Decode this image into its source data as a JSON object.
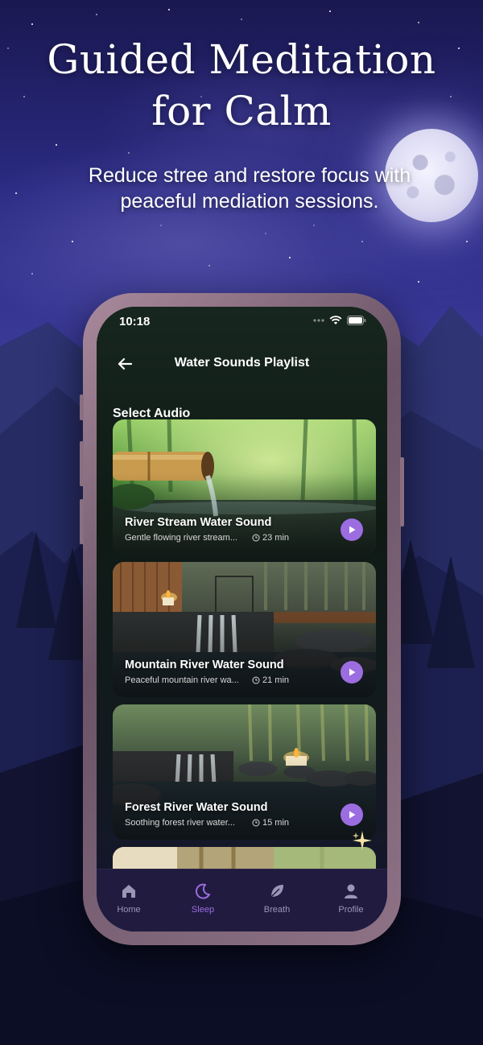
{
  "hero": {
    "title_line1": "Guided Meditation",
    "title_line2": "for Calm",
    "subtitle_line1": "Reduce stree and restore focus with",
    "subtitle_line2": "peaceful mediation sessions."
  },
  "status_bar": {
    "time": "10:18"
  },
  "header": {
    "title": "Water Sounds Playlist"
  },
  "section_title": "Select Audio",
  "tracks": [
    {
      "title": "River Stream Water Sound",
      "description": "Gentle flowing river stream...",
      "duration": "23 min"
    },
    {
      "title": "Mountain River Water Sound",
      "description": "Peaceful mountain river wa...",
      "duration": "21 min"
    },
    {
      "title": "Forest River Water Sound",
      "description": "Soothing forest river water...",
      "duration": "15 min"
    }
  ],
  "tabs": [
    {
      "label": "Home",
      "icon": "home-icon"
    },
    {
      "label": "Sleep",
      "icon": "moon-icon",
      "active": true
    },
    {
      "label": "Breath",
      "icon": "leaf-icon"
    },
    {
      "label": "Profile",
      "icon": "person-icon"
    }
  ],
  "colors": {
    "accent": "#9b6de0",
    "tab_bar": "#211b40",
    "sky": "#2a2a82"
  }
}
